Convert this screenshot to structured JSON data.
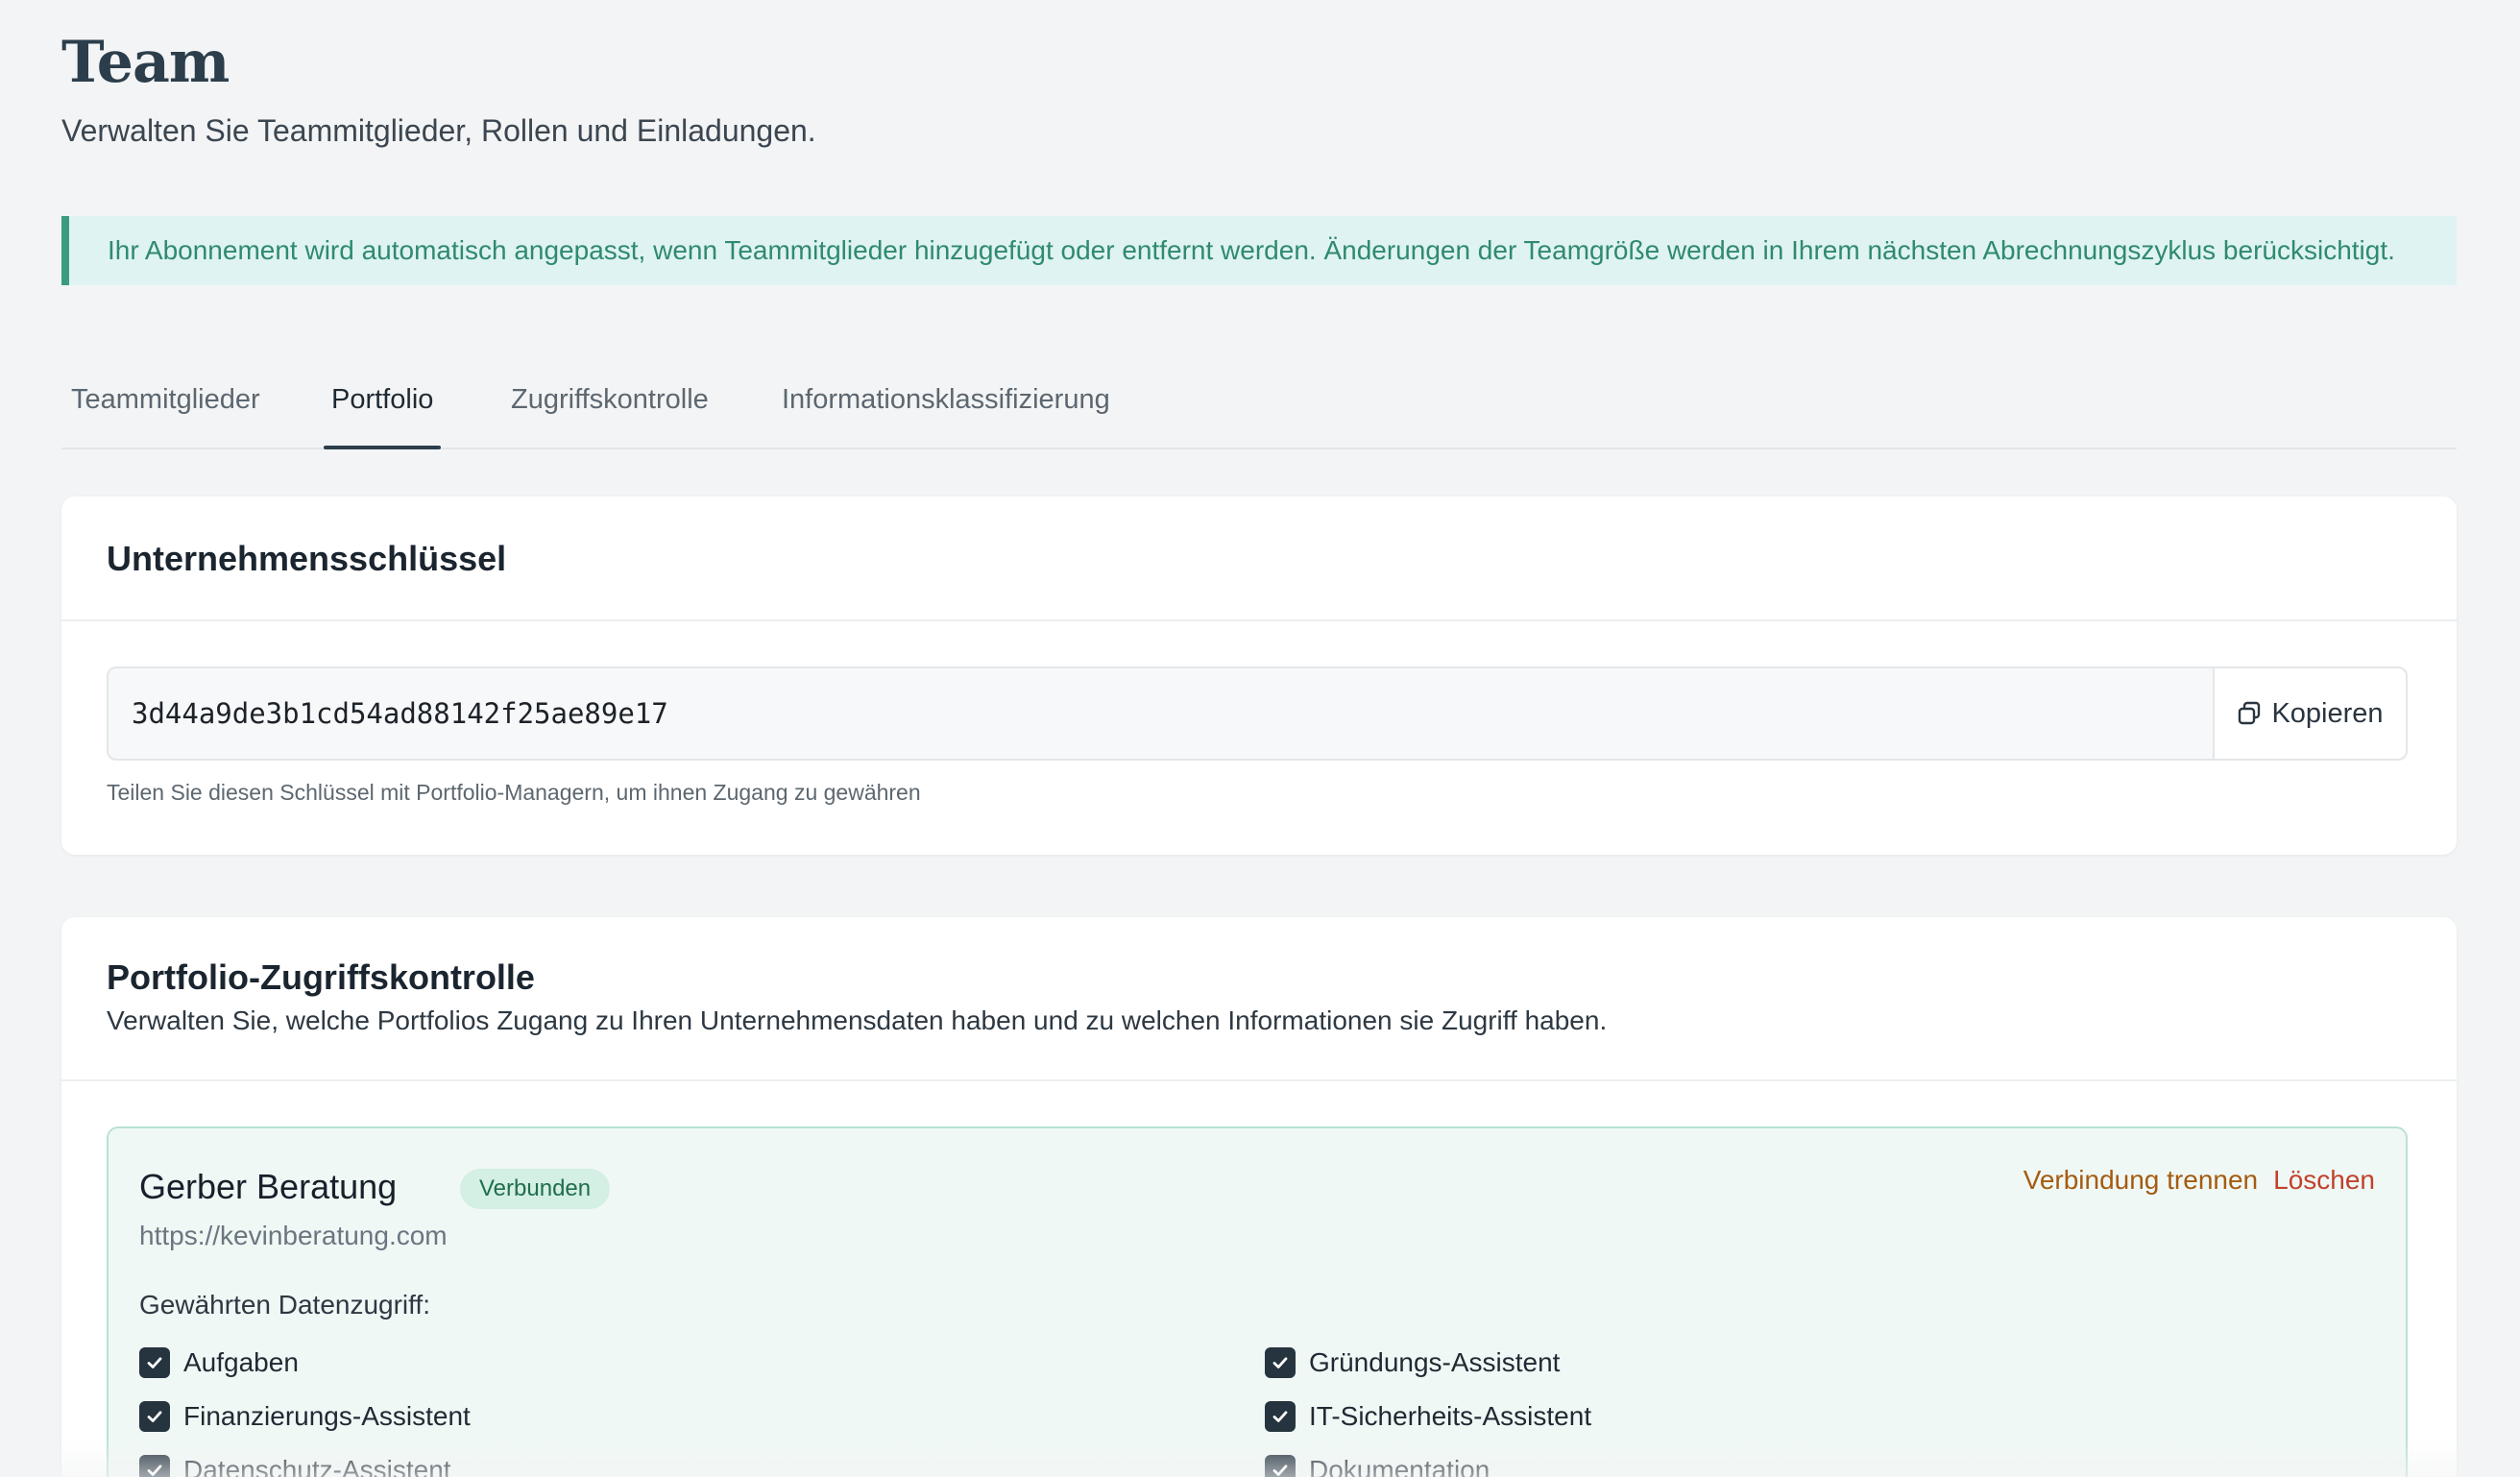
{
  "header": {
    "title": "Team",
    "subtitle": "Verwalten Sie Teammitglieder, Rollen und Einladungen."
  },
  "banner": {
    "text": "Ihr Abonnement wird automatisch angepasst, wenn Teammitglieder hinzugefügt oder entfernt werden. Änderungen der Teamgröße werden in Ihrem nächsten Abrechnungszyklus berücksichtigt."
  },
  "tabs": [
    {
      "label": "Teammitglieder",
      "active": false
    },
    {
      "label": "Portfolio",
      "active": true
    },
    {
      "label": "Zugriffskontrolle",
      "active": false
    },
    {
      "label": "Informationsklassifizierung",
      "active": false
    }
  ],
  "company_key": {
    "title": "Unternehmensschlüssel",
    "value": "3d44a9de3b1cd54ad88142f25ae89e17",
    "copy_label": "Kopieren",
    "hint": "Teilen Sie diesen Schlüssel mit Portfolio-Managern, um ihnen Zugang zu gewähren"
  },
  "portfolio_access": {
    "title": "Portfolio-Zugriffskontrolle",
    "description": "Verwalten Sie, welche Portfolios Zugang zu Ihren Unternehmensdaten haben und zu welchen Informationen sie Zugriff haben.",
    "items": [
      {
        "name": "Gerber Beratung",
        "status": "Verbunden",
        "url": "https://kevinberatung.com",
        "disconnect_label": "Verbindung trennen",
        "delete_label": "Löschen",
        "access_label": "Gewährten Datenzugriff:",
        "permissions": [
          {
            "label": "Aufgaben",
            "checked": true
          },
          {
            "label": "Gründungs-Assistent",
            "checked": true
          },
          {
            "label": "Finanzierungs-Assistent",
            "checked": true
          },
          {
            "label": "IT-Sicherheits-Assistent",
            "checked": true
          },
          {
            "label": "Datenschutz-Assistent",
            "checked": true
          },
          {
            "label": "Dokumentation",
            "checked": true
          }
        ]
      }
    ]
  },
  "colors": {
    "accent": "#2c3e4b",
    "banner_bg": "#dff3f3",
    "banner_text": "#2f8a6f",
    "connected_bg": "#d4efe3",
    "disconnect": "#a55b10",
    "delete": "#c2412d"
  }
}
